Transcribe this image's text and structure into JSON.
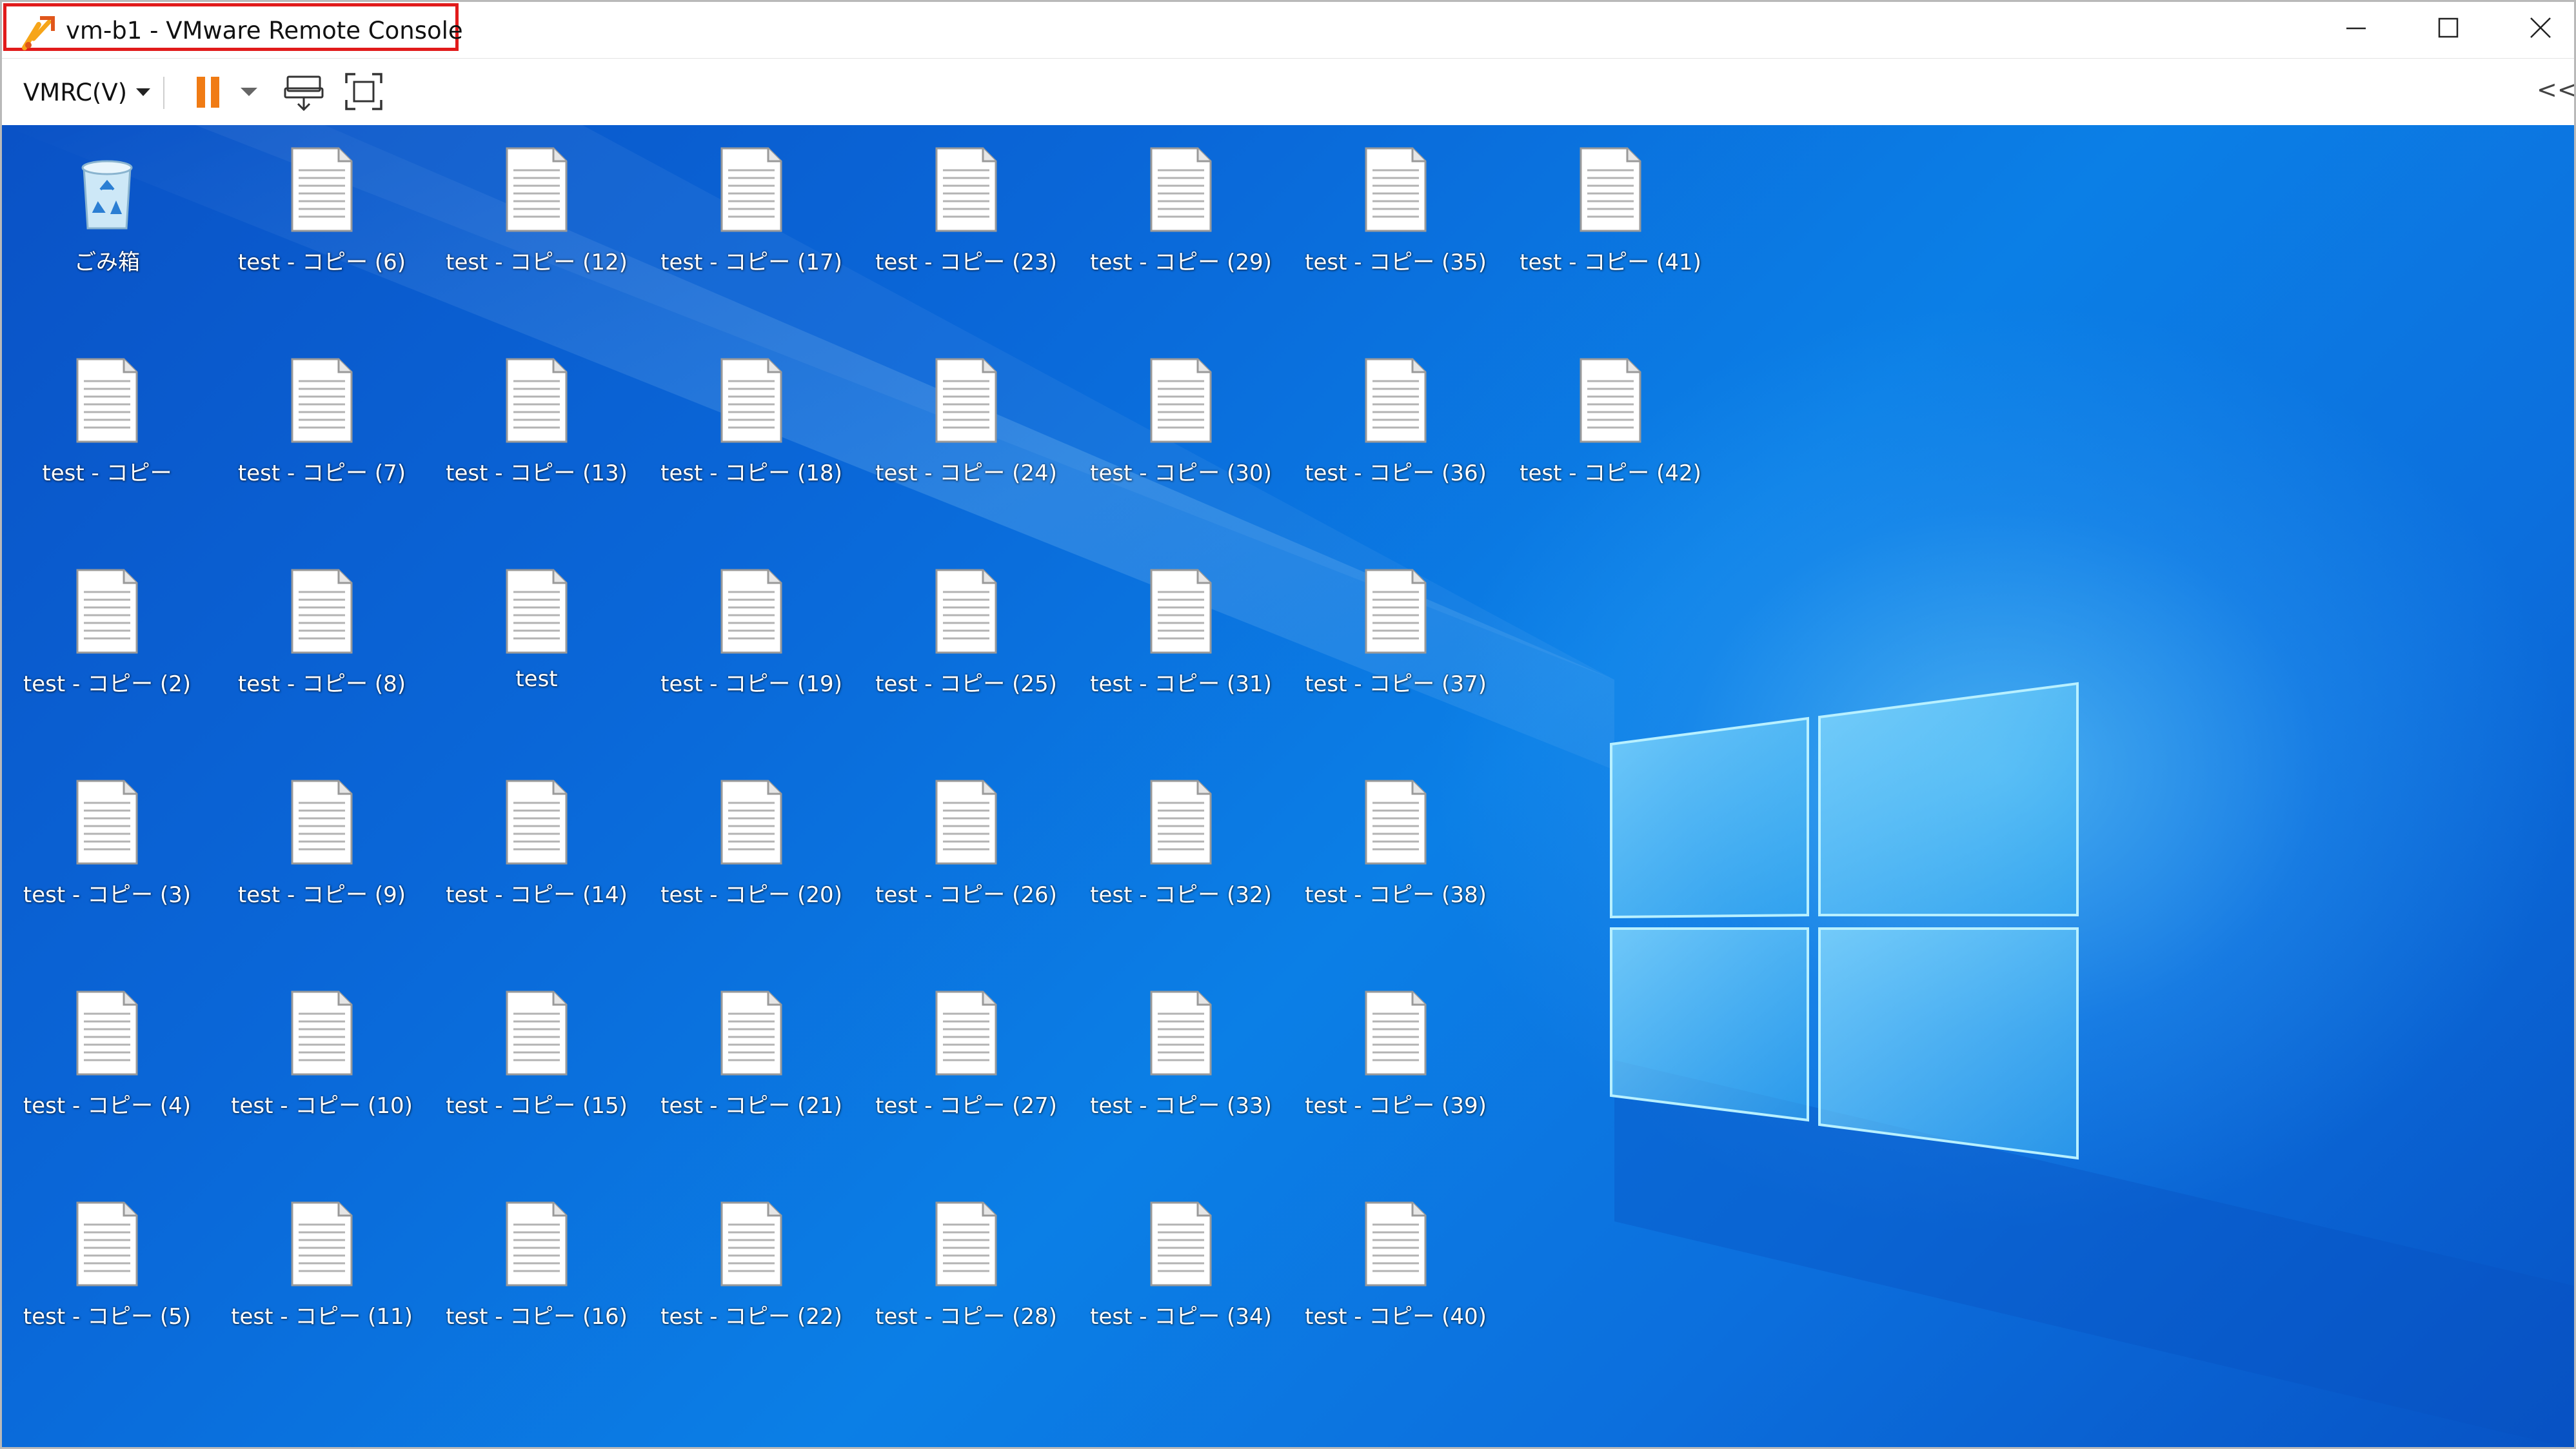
{
  "window": {
    "title": "vm-b1 - VMware Remote Console",
    "controls": [
      "minimize-icon",
      "maximize-icon",
      "close-icon"
    ]
  },
  "toolbar": {
    "vmrc_menu_label": "VMRC(V)",
    "pause_icon": "pause-icon",
    "send_keys_icon": "ctrl-alt-del-icon",
    "fullscreen_icon": "fullscreen-icon",
    "library_toggle": "<<",
    "pause_color": "#f07b14"
  },
  "desktop": {
    "recycle_bin": {
      "label": "ごみ箱",
      "icon": "recycle-bin-icon"
    },
    "columns": [
      [
        "test - コピー",
        "test - コピー (2)",
        "test - コピー (3)",
        "test - コピー (4)",
        "test - コピー (5)"
      ],
      [
        "test - コピー (6)",
        "test - コピー (7)",
        "test - コピー (8)",
        "test - コピー (9)",
        "test - コピー (10)",
        "test - コピー (11)"
      ],
      [
        "test - コピー (12)",
        "test - コピー (13)",
        "test",
        "test - コピー (14)",
        "test - コピー (15)",
        "test - コピー (16)"
      ],
      [
        "test - コピー (17)",
        "test - コピー (18)",
        "test - コピー (19)",
        "test - コピー (20)",
        "test - コピー (21)",
        "test - コピー (22)"
      ],
      [
        "test - コピー (23)",
        "test - コピー (24)",
        "test - コピー (25)",
        "test - コピー (26)",
        "test - コピー (27)",
        "test - コピー (28)"
      ],
      [
        "test - コピー (29)",
        "test - コピー (30)",
        "test - コピー (31)",
        "test - コピー (32)",
        "test - コピー (33)",
        "test - コピー (34)"
      ],
      [
        "test - コピー (35)",
        "test - コピー (36)",
        "test - コピー (37)",
        "test - コピー (38)",
        "test - コピー (39)",
        "test - コピー (40)"
      ],
      [
        "test - コピー (41)",
        "test - コピー (42)"
      ]
    ],
    "file_icon": "text-file-icon",
    "wallpaper": "windows-logo-wallpaper",
    "colors": {
      "background_dark": "#0a52c6",
      "background_light": "#0b7fe6",
      "logo_pane": "#5cc8f5",
      "highlight": "#e11b1b"
    }
  }
}
